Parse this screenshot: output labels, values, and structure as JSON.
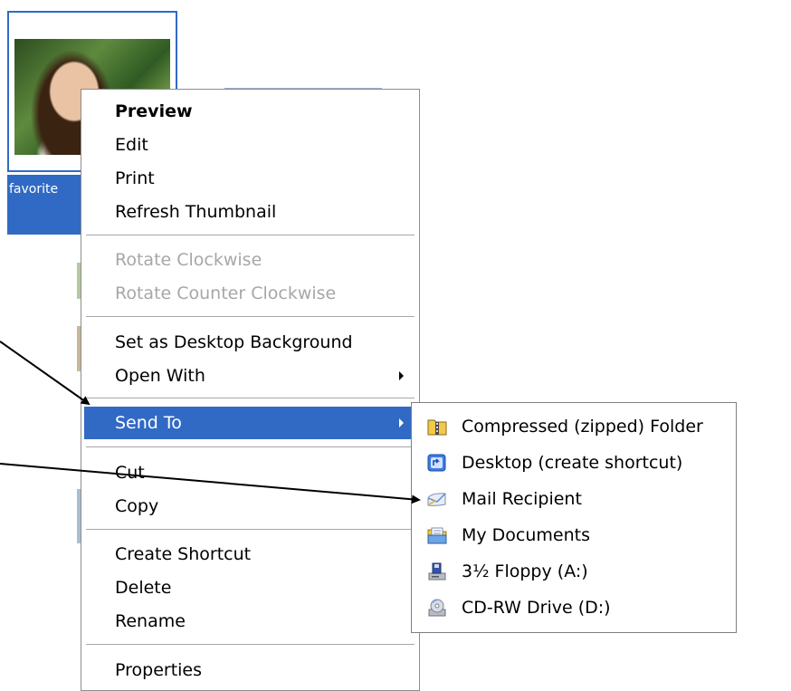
{
  "desktop": {
    "file_caption": "favorite"
  },
  "context_menu": {
    "items": [
      {
        "label": "Preview"
      },
      {
        "label": "Edit"
      },
      {
        "label": "Print"
      },
      {
        "label": "Refresh Thumbnail"
      },
      {
        "label": "Rotate Clockwise"
      },
      {
        "label": "Rotate Counter Clockwise"
      },
      {
        "label": "Set as Desktop Background"
      },
      {
        "label": "Open With"
      },
      {
        "label": "Send To"
      },
      {
        "label": "Cut"
      },
      {
        "label": "Copy"
      },
      {
        "label": "Create Shortcut"
      },
      {
        "label": "Delete"
      },
      {
        "label": "Rename"
      },
      {
        "label": "Properties"
      }
    ]
  },
  "send_to_menu": {
    "items": [
      {
        "label": "Compressed (zipped) Folder",
        "icon": "zip-folder-icon"
      },
      {
        "label": "Desktop (create shortcut)",
        "icon": "desktop-shortcut-icon"
      },
      {
        "label": "Mail Recipient",
        "icon": "mail-recipient-icon"
      },
      {
        "label": "My Documents",
        "icon": "my-documents-icon"
      },
      {
        "label": "3½ Floppy (A:)",
        "icon": "floppy-drive-icon"
      },
      {
        "label": "CD-RW Drive (D:)",
        "icon": "cd-drive-icon"
      }
    ]
  },
  "colors": {
    "selection_blue": "#316ac5",
    "disabled_text": "#a7a7a7",
    "menu_border": "#8d8d8d"
  }
}
